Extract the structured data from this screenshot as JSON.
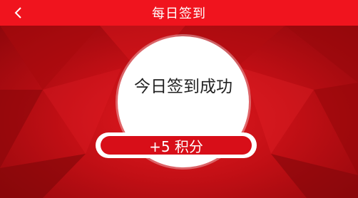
{
  "nav": {
    "title": "每日签到",
    "back_icon": "chevron-left-icon"
  },
  "checkin": {
    "status": "今日签到成功",
    "reward": "+5 积分"
  },
  "colors": {
    "nav_bg": "#f0141e",
    "hero_base": "#c20f15",
    "reward_pill": "#d80e18",
    "text_light": "#ffffff",
    "text_dark": "#222222"
  }
}
